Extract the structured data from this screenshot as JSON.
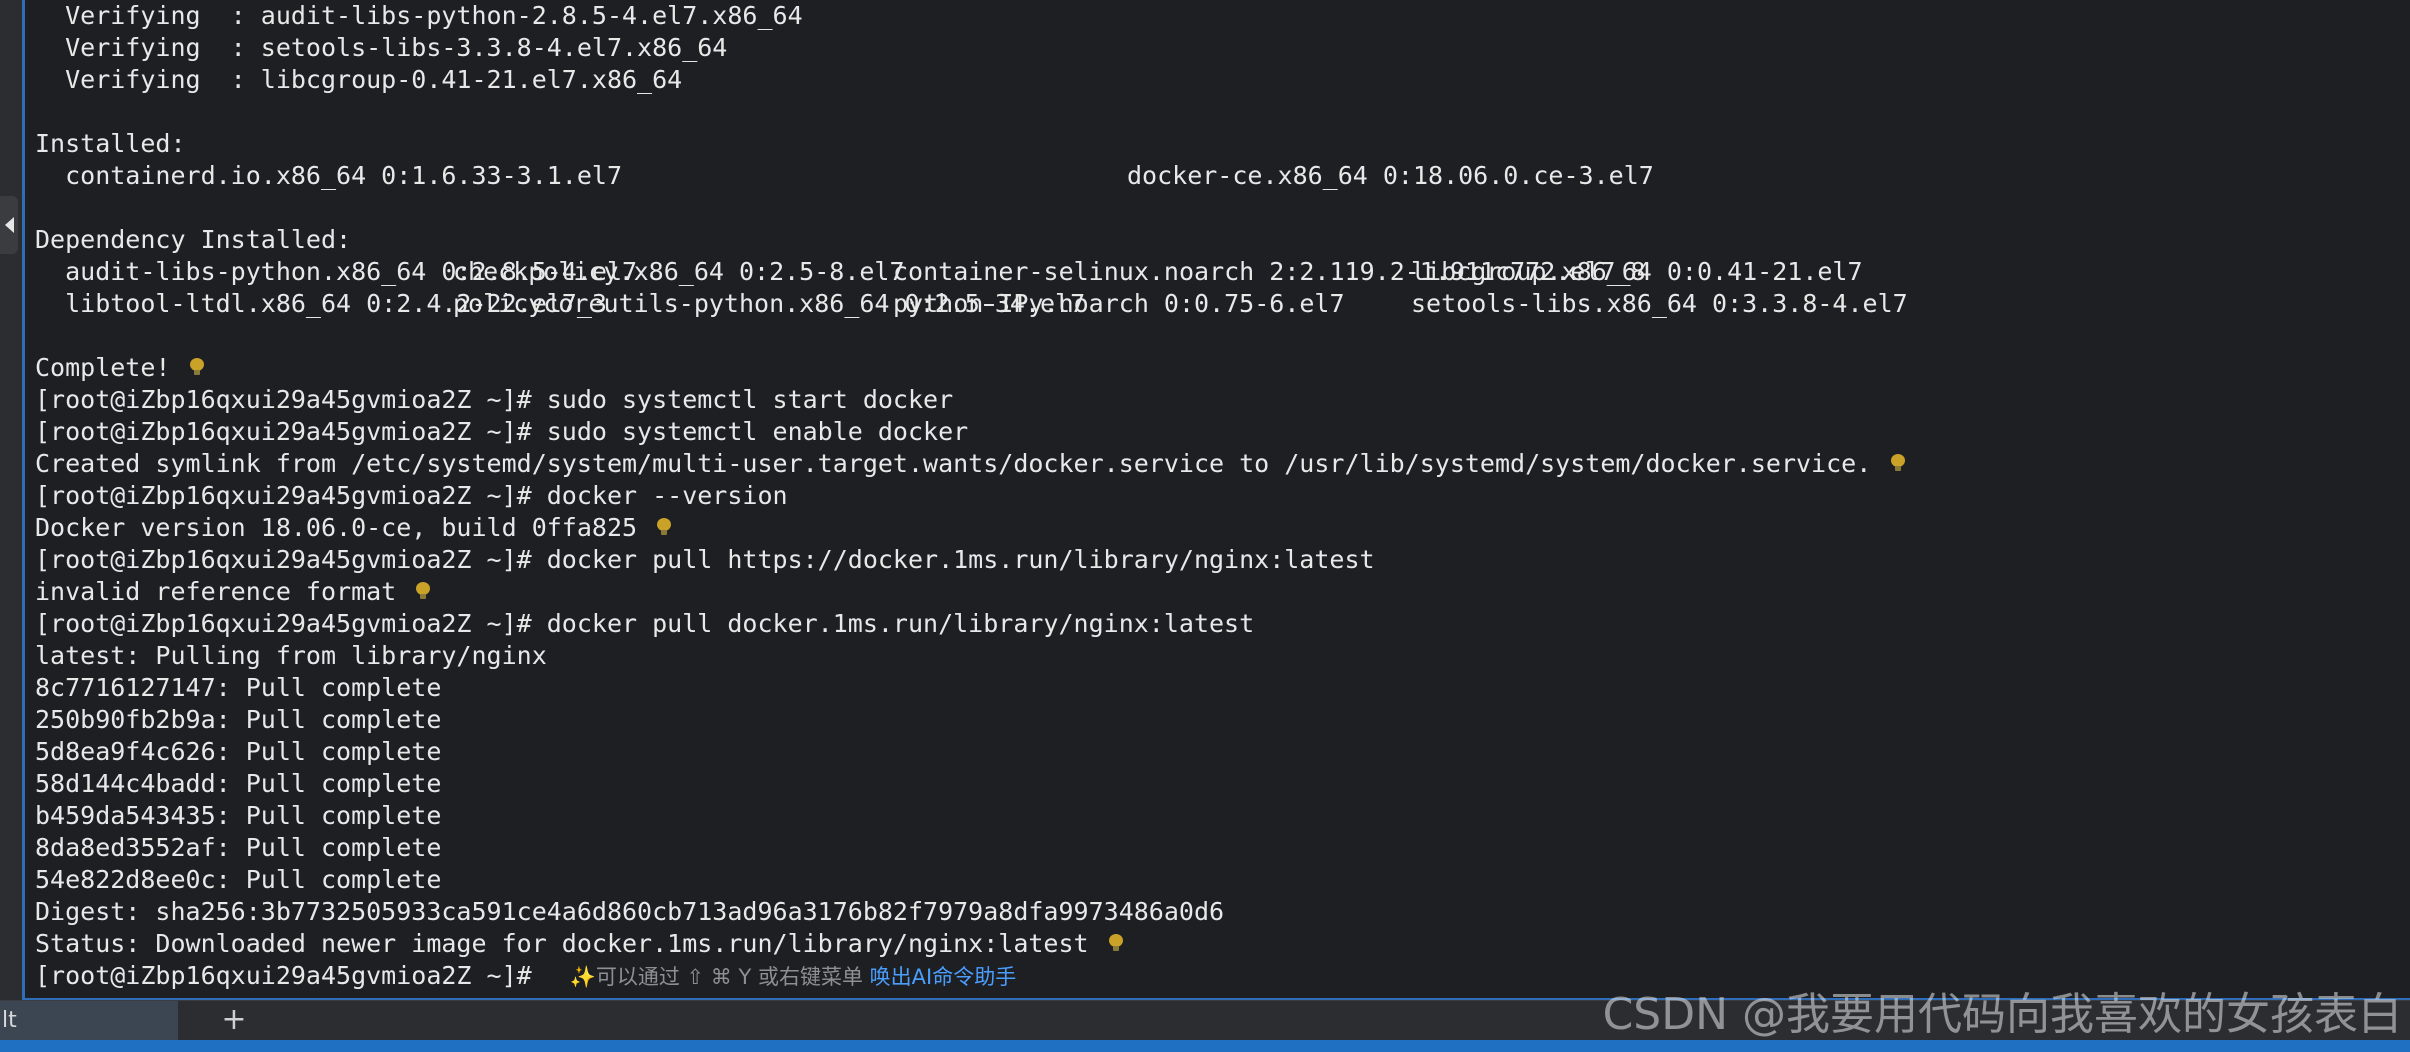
{
  "terminal": {
    "lines": [
      {
        "text": "  Verifying  : audit-libs-python-2.8.5-4.el7.x86_64"
      },
      {
        "text": "  Verifying  : setools-libs-3.3.8-4.el7.x86_64"
      },
      {
        "text": "  Verifying  : libcgroup-0.41-21.el7.x86_64"
      },
      {
        "text": ""
      },
      {
        "text": "Installed:"
      },
      {
        "cols": [
          {
            "text": "  containerd.io.x86_64 0:1.6.33-3.1.el7"
          },
          {
            "text": "docker-ce.x86_64 0:18.06.0.ce-3.el7"
          }
        ]
      },
      {
        "text": ""
      },
      {
        "text": "Dependency Installed:"
      },
      {
        "cols": [
          {
            "text": "  audit-libs-python.x86_64 0:2.8.5-4.el7"
          },
          {
            "text": "checkpolicy.x86_64 0:2.5-8.el7"
          },
          {
            "text": "container-selinux.noarch 2:2.119.2-1.911c772.el7_8"
          },
          {
            "text": "libcgroup.x86_64 0:0.41-21.el7"
          }
        ]
      },
      {
        "cols": [
          {
            "text": "  libtool-ltdl.x86_64 0:2.4.2-22.el7_3"
          },
          {
            "text": "policycoreutils-python.x86_64 0:2.5-34.el7"
          },
          {
            "text": "python-IPy.noarch 0:0.75-6.el7"
          },
          {
            "text": "setools-libs.x86_64 0:3.3.8-4.el7"
          }
        ]
      },
      {
        "text": ""
      },
      {
        "text": "Complete!",
        "bulb": true
      },
      {
        "text": "[root@iZbp16qxui29a45gvmioa2Z ~]# sudo systemctl start docker"
      },
      {
        "text": "[root@iZbp16qxui29a45gvmioa2Z ~]# sudo systemctl enable docker"
      },
      {
        "text": "Created symlink from /etc/systemd/system/multi-user.target.wants/docker.service to /usr/lib/systemd/system/docker.service.",
        "bulb": true
      },
      {
        "text": "[root@iZbp16qxui29a45gvmioa2Z ~]# docker --version"
      },
      {
        "text": "Docker version 18.06.0-ce, build 0ffa825",
        "bulb": true
      },
      {
        "text": "[root@iZbp16qxui29a45gvmioa2Z ~]# docker pull https://docker.1ms.run/library/nginx:latest"
      },
      {
        "text": "invalid reference format",
        "bulb": true
      },
      {
        "text": "[root@iZbp16qxui29a45gvmioa2Z ~]# docker pull docker.1ms.run/library/nginx:latest"
      },
      {
        "text": "latest: Pulling from library/nginx"
      },
      {
        "text": "8c7716127147: Pull complete"
      },
      {
        "text": "250b90fb2b9a: Pull complete"
      },
      {
        "text": "5d8ea9f4c626: Pull complete"
      },
      {
        "text": "58d144c4badd: Pull complete"
      },
      {
        "text": "b459da543435: Pull complete"
      },
      {
        "text": "8da8ed3552af: Pull complete"
      },
      {
        "text": "54e822d8ee0c: Pull complete"
      },
      {
        "text": "Digest: sha256:3b7732505933ca591ce4a6d860cb713ad96a3176b82f7979a8dfa9973486a0d6"
      },
      {
        "text": "Status: Downloaded newer image for docker.1ms.run/library/nginx:latest",
        "bulb": true
      }
    ],
    "prompt": "[root@iZbp16qxui29a45gvmioa2Z ~]#",
    "hint_sparkle": "✨",
    "hint_text": "可以通过 ⇧ ⌘ Y 或右键菜单 ",
    "hint_link": "唤出AI命令助手"
  },
  "tabs": {
    "active_label": "lt",
    "add_label": "+"
  },
  "watermark": "CSDN @我要用代码向我喜欢的女孩表白",
  "colors": {
    "background": "#1e1f22",
    "text": "#e8e8e8",
    "accent": "#2f6db8",
    "link": "#4a9eff",
    "bulb": "#c9a227"
  }
}
